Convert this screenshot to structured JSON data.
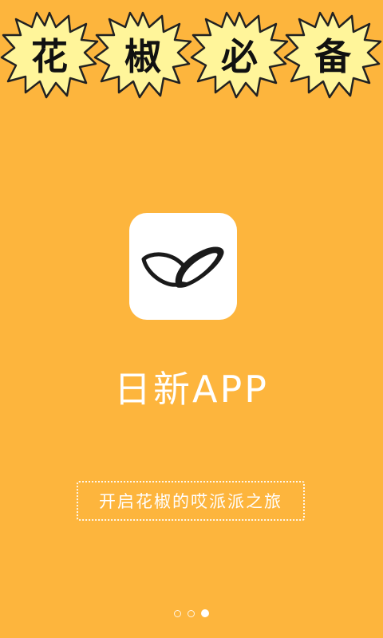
{
  "banner": {
    "badges": [
      "花",
      "椒",
      "必",
      "备"
    ]
  },
  "app": {
    "icon": "leaf-logo-icon",
    "name": "日新APP"
  },
  "slogan": "开启花椒的哎派派之旅",
  "pager": {
    "total": 3,
    "active_index": 2
  },
  "colors": {
    "background": "#FDB53D",
    "badge_fill": "#FFF59A",
    "text": "#FFFFFF"
  }
}
